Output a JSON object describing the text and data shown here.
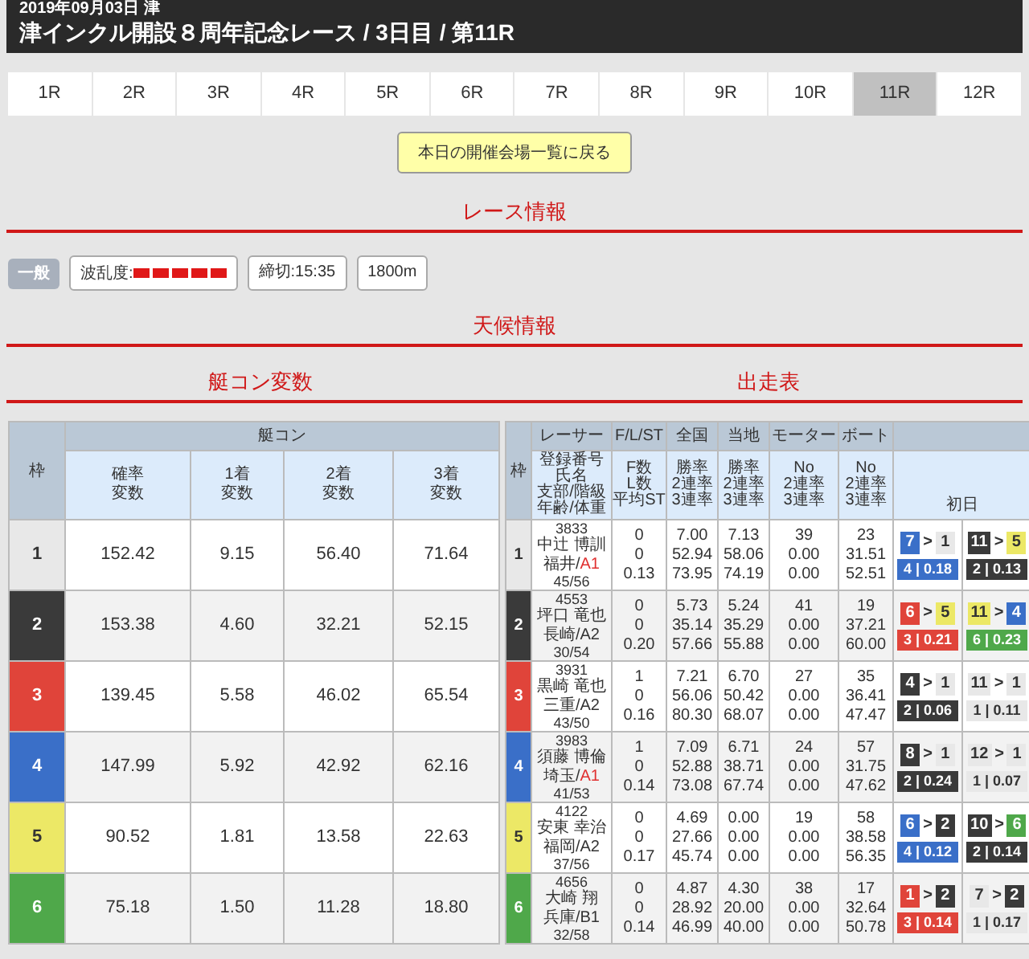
{
  "header": {
    "date": "2019年09月03日 津",
    "title": "津インクル開設８周年記念レース / 3日目 / 第11R"
  },
  "race_tabs": [
    {
      "label": "1R",
      "selected": false
    },
    {
      "label": "2R",
      "selected": false
    },
    {
      "label": "3R",
      "selected": false
    },
    {
      "label": "4R",
      "selected": false
    },
    {
      "label": "5R",
      "selected": false
    },
    {
      "label": "6R",
      "selected": false
    },
    {
      "label": "7R",
      "selected": false
    },
    {
      "label": "8R",
      "selected": false
    },
    {
      "label": "9R",
      "selected": false
    },
    {
      "label": "10R",
      "selected": false
    },
    {
      "label": "11R",
      "selected": true
    },
    {
      "label": "12R",
      "selected": false
    }
  ],
  "back_button": "本日の開催会場一覧に戻る",
  "race_info": {
    "heading": "レース情報",
    "category": "一般",
    "volatility_label": "波乱度:",
    "volatility": {
      "stars": 5
    },
    "deadline": "締切:15:35",
    "distance": "1800m"
  },
  "weather": {
    "heading": "天候情報"
  },
  "boat_con": {
    "heading": "艇コン変数",
    "frame_header": "枠",
    "group_header": "艇コン",
    "columns": [
      [
        "確率",
        "変数"
      ],
      [
        "1着",
        "変数"
      ],
      [
        "2着",
        "変数"
      ],
      [
        "3着",
        "変数"
      ]
    ],
    "rows": [
      {
        "frame": "1",
        "color": "#e8e8e8",
        "values": [
          "152.42",
          "9.15",
          "56.40",
          "71.64"
        ]
      },
      {
        "frame": "2",
        "color": "#3a3a3a",
        "values": [
          "153.38",
          "4.60",
          "32.21",
          "52.15"
        ]
      },
      {
        "frame": "3",
        "color": "#e0443a",
        "values": [
          "139.45",
          "5.58",
          "46.02",
          "65.54"
        ]
      },
      {
        "frame": "4",
        "color": "#3a6fc8",
        "values": [
          "147.99",
          "5.92",
          "42.92",
          "62.16"
        ]
      },
      {
        "frame": "5",
        "color": "#ece866",
        "values": [
          "90.52",
          "1.81",
          "13.58",
          "22.63"
        ]
      },
      {
        "frame": "6",
        "color": "#4fa84a",
        "values": [
          "75.18",
          "1.50",
          "11.28",
          "18.80"
        ]
      }
    ]
  },
  "entry_table": {
    "heading": "出走表",
    "frame_header": "枠",
    "day_header": "初日",
    "columns": [
      {
        "title": "レーサー",
        "sub": [
          "登録番号",
          "氏名",
          "支部/階級",
          "年齢/体重"
        ]
      },
      {
        "title": "F/L/ST",
        "sub": [
          "F数",
          "L数",
          "平均ST"
        ]
      },
      {
        "title": "全国",
        "sub": [
          "勝率",
          "2連率",
          "3連率"
        ]
      },
      {
        "title": "当地",
        "sub": [
          "勝率",
          "2連率",
          "3連率"
        ]
      },
      {
        "title": "モーター",
        "sub": [
          "No",
          "2連率",
          "3連率"
        ]
      },
      {
        "title": "ボート",
        "sub": [
          "No",
          "2連率",
          "3連率"
        ]
      }
    ],
    "rows": [
      {
        "frame": "1",
        "color": "#e8e8e8",
        "racer": {
          "id": "3833",
          "name": "中辻 博訓",
          "branch": "福井/",
          "grade": {
            "text": "A1",
            "color": "#e03030"
          },
          "age_weight": "45/56"
        },
        "stats": [
          [
            "0",
            "0",
            "0.13"
          ],
          [
            "7.00",
            "52.94",
            "73.95"
          ],
          [
            "7.13",
            "58.06",
            "74.19"
          ],
          [
            "39",
            "0.00",
            "0.00"
          ],
          [
            "23",
            "31.51",
            "52.51"
          ]
        ],
        "results": [
          {
            "race": {
              "text": "7",
              "color": "#3a6fc8"
            },
            "separator": ">",
            "finish": {
              "text": "1",
              "color": "#e8e8e8"
            },
            "course_st": {
              "text": "4 | 0.18",
              "color": "#3a6fc8"
            }
          },
          {
            "race": {
              "text": "11",
              "color": "#3a3a3a"
            },
            "separator": ">",
            "finish": {
              "text": "5",
              "color": "#ece866"
            },
            "course_st": {
              "text": "2 | 0.13",
              "color": "#3a3a3a"
            }
          }
        ]
      },
      {
        "frame": "2",
        "color": "#3a3a3a",
        "racer": {
          "id": "4553",
          "name": "坪口 竜也",
          "branch": "長崎/",
          "grade": {
            "text": "A2",
            "color": "#333333"
          },
          "age_weight": "30/54"
        },
        "stats": [
          [
            "0",
            "0",
            "0.20"
          ],
          [
            "5.73",
            "35.14",
            "57.66"
          ],
          [
            "5.24",
            "35.29",
            "55.88"
          ],
          [
            "41",
            "0.00",
            "0.00"
          ],
          [
            "19",
            "37.21",
            "60.00"
          ]
        ],
        "results": [
          {
            "race": {
              "text": "6",
              "color": "#e0443a"
            },
            "separator": ">",
            "finish": {
              "text": "5",
              "color": "#ece866"
            },
            "course_st": {
              "text": "3 | 0.21",
              "color": "#e0443a"
            }
          },
          {
            "race": {
              "text": "11",
              "color": "#ece866"
            },
            "separator": ">",
            "finish": {
              "text": "4",
              "color": "#3a6fc8"
            },
            "course_st": {
              "text": "6 | 0.23",
              "color": "#4fa84a"
            }
          }
        ]
      },
      {
        "frame": "3",
        "color": "#e0443a",
        "racer": {
          "id": "3931",
          "name": "黒崎 竜也",
          "branch": "三重/",
          "grade": {
            "text": "A2",
            "color": "#333333"
          },
          "age_weight": "43/50"
        },
        "stats": [
          [
            "1",
            "0",
            "0.16"
          ],
          [
            "7.21",
            "56.06",
            "80.30"
          ],
          [
            "6.70",
            "50.42",
            "68.07"
          ],
          [
            "27",
            "0.00",
            "0.00"
          ],
          [
            "35",
            "36.41",
            "47.47"
          ]
        ],
        "results": [
          {
            "race": {
              "text": "4",
              "color": "#3a3a3a"
            },
            "separator": ">",
            "finish": {
              "text": "1",
              "color": "#e8e8e8"
            },
            "course_st": {
              "text": "2 | 0.06",
              "color": "#3a3a3a"
            }
          },
          {
            "race": {
              "text": "11",
              "color": "#e8e8e8"
            },
            "separator": ">",
            "finish": {
              "text": "1",
              "color": "#e8e8e8"
            },
            "course_st": {
              "text": "1 | 0.11",
              "color": "#e8e8e8"
            }
          }
        ]
      },
      {
        "frame": "4",
        "color": "#3a6fc8",
        "racer": {
          "id": "3983",
          "name": "須藤 博倫",
          "branch": "埼玉/",
          "grade": {
            "text": "A1",
            "color": "#e03030"
          },
          "age_weight": "41/53"
        },
        "stats": [
          [
            "1",
            "0",
            "0.14"
          ],
          [
            "7.09",
            "52.88",
            "73.08"
          ],
          [
            "6.71",
            "38.71",
            "67.74"
          ],
          [
            "24",
            "0.00",
            "0.00"
          ],
          [
            "57",
            "31.75",
            "47.62"
          ]
        ],
        "results": [
          {
            "race": {
              "text": "8",
              "color": "#3a3a3a"
            },
            "separator": ">",
            "finish": {
              "text": "1",
              "color": "#e8e8e8"
            },
            "course_st": {
              "text": "2 | 0.24",
              "color": "#3a3a3a"
            }
          },
          {
            "race": {
              "text": "12",
              "color": "#e8e8e8"
            },
            "separator": ">",
            "finish": {
              "text": "1",
              "color": "#e8e8e8"
            },
            "course_st": {
              "text": "1 | 0.07",
              "color": "#e8e8e8"
            }
          }
        ]
      },
      {
        "frame": "5",
        "color": "#ece866",
        "racer": {
          "id": "4122",
          "name": "安東 幸治",
          "branch": "福岡/",
          "grade": {
            "text": "A2",
            "color": "#333333"
          },
          "age_weight": "37/56"
        },
        "stats": [
          [
            "0",
            "0",
            "0.17"
          ],
          [
            "4.69",
            "27.66",
            "45.74"
          ],
          [
            "0.00",
            "0.00",
            "0.00"
          ],
          [
            "19",
            "0.00",
            "0.00"
          ],
          [
            "58",
            "38.58",
            "56.35"
          ]
        ],
        "results": [
          {
            "race": {
              "text": "6",
              "color": "#3a6fc8"
            },
            "separator": ">",
            "finish": {
              "text": "2",
              "color": "#3a3a3a"
            },
            "course_st": {
              "text": "4 | 0.12",
              "color": "#3a6fc8"
            }
          },
          {
            "race": {
              "text": "10",
              "color": "#3a3a3a"
            },
            "separator": ">",
            "finish": {
              "text": "6",
              "color": "#4fa84a"
            },
            "course_st": {
              "text": "2 | 0.14",
              "color": "#3a3a3a"
            }
          }
        ]
      },
      {
        "frame": "6",
        "color": "#4fa84a",
        "racer": {
          "id": "4656",
          "name": "大崎 翔",
          "branch": "兵庫/",
          "grade": {
            "text": "B1",
            "color": "#333333"
          },
          "age_weight": "32/58"
        },
        "stats": [
          [
            "0",
            "0",
            "0.14"
          ],
          [
            "4.87",
            "28.92",
            "46.99"
          ],
          [
            "4.30",
            "20.00",
            "40.00"
          ],
          [
            "38",
            "0.00",
            "0.00"
          ],
          [
            "17",
            "32.64",
            "50.78"
          ]
        ],
        "results": [
          {
            "race": {
              "text": "1",
              "color": "#e0443a"
            },
            "separator": ">",
            "finish": {
              "text": "2",
              "color": "#3a3a3a"
            },
            "course_st": {
              "text": "3 | 0.14",
              "color": "#e0443a"
            }
          },
          {
            "race": {
              "text": "7",
              "color": "#e8e8e8"
            },
            "separator": ">",
            "finish": {
              "text": "2",
              "color": "#3a3a3a"
            },
            "course_st": {
              "text": "1 | 0.17",
              "color": "#e8e8e8"
            }
          }
        ]
      }
    ]
  }
}
